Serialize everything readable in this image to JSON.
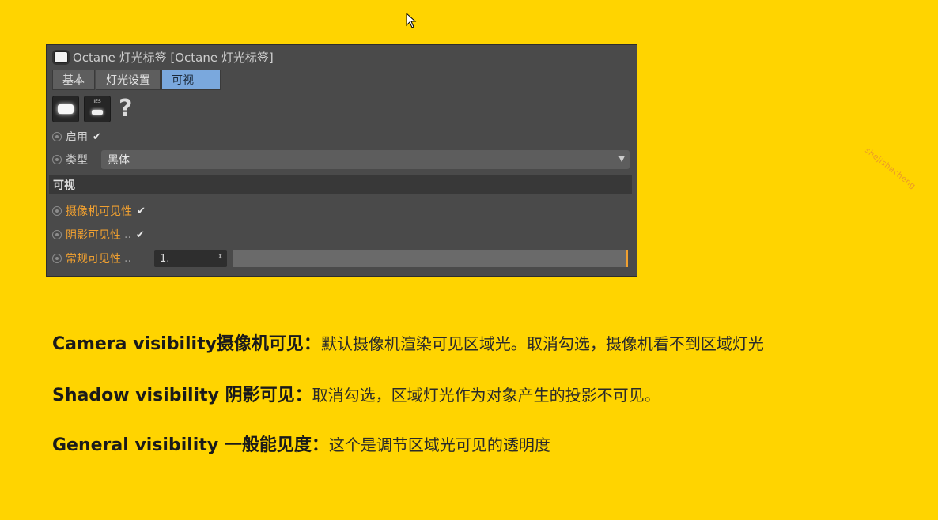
{
  "window": {
    "title": "Octane 灯光标签 [Octane 灯光标签]"
  },
  "tabs": [
    {
      "label": "基本",
      "active": false
    },
    {
      "label": "灯光设置",
      "active": false
    },
    {
      "label": "可视",
      "active": true
    }
  ],
  "icons": {
    "light_icon": "lamp-icon",
    "ies_icon": "ies-lamp-icon",
    "ies_label": "IES",
    "help": "?"
  },
  "fields": {
    "enable_label": "启用",
    "enable_checked": "✔",
    "type_label": "类型",
    "type_value": "黑体",
    "section_label": "可视",
    "camera_label": "摄像机可见性",
    "camera_checked": "✔",
    "shadow_label": "阴影可见性",
    "shadow_dots": "..",
    "shadow_checked": "✔",
    "general_label": "常规可见性",
    "general_dots": "..",
    "general_value": "1.",
    "general_slider_level": 1.0
  },
  "descriptions": [
    {
      "title": "Camera visibility摄像机可见：",
      "text": "默认摄像机渲染可见区域光。取消勾选，摄像机看不到区域灯光"
    },
    {
      "title": "Shadow visibility 阴影可见：",
      "text": "取消勾选，区域灯光作为对象产生的投影不可见。"
    },
    {
      "title": "General visibility 一般能见度：",
      "text": "这个是调节区域光可见的透明度"
    }
  ],
  "watermark": "shejishacheng",
  "colors": {
    "background": "#FFD400",
    "panel": "#4a4a4a",
    "active_tab": "#7aa8dd",
    "accent_orange": "#f0a030"
  }
}
